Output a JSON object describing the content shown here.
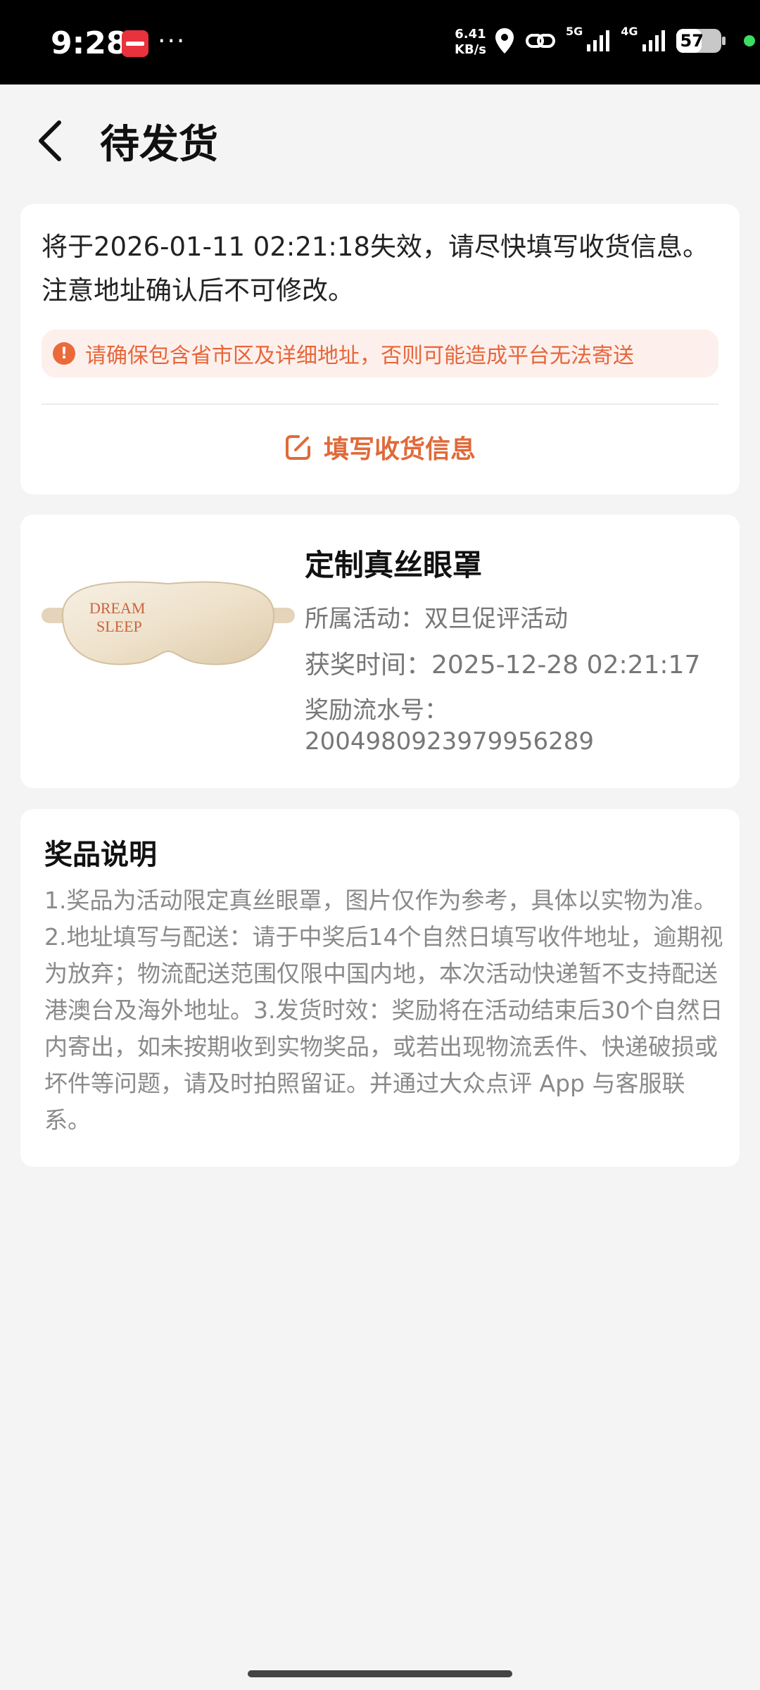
{
  "status_bar": {
    "time": "9:28",
    "dots": "···",
    "net_speed_value": "6.41",
    "net_speed_unit": "KB/s",
    "signal_5g": "5G",
    "signal_4g": "4G",
    "battery": "57",
    "battery_level": 0.57
  },
  "header": {
    "title": "待发货",
    "back_icon": "chevron-left-icon"
  },
  "address_card": {
    "expire_text": "将于2026-01-11 02:21:18失效，请尽快填写收货信息。注意地址确认后不可修改。",
    "warning_icon": "!",
    "warning_text": "请确保包含省市区及详细地址，否则可能造成平台无法寄送",
    "fill_button_label": "填写收货信息"
  },
  "product_card": {
    "name": "定制真丝眼罩",
    "activity": "所属活动：双旦促评活动",
    "award_time": "获奖时间：2025-12-28 02:21:17",
    "serial_label": "奖励流水号：",
    "serial_number": "2004980923979956289",
    "image_text": "DREAM SLEEP"
  },
  "description_card": {
    "title": "奖品说明",
    "text": "1.奖品为活动限定真丝眼罩，图片仅作为参考，具体以实物为准。2.地址填写与配送：请于中奖后14个自然日填写收件地址，逾期视为放弃；物流配送范围仅限中国内地，本次活动快递暂不支持配送港澳台及海外地址。3.发货时效：奖励将在活动结束后30个自然日内寄出，如未按期收到实物奖品，或若出现物流丢件、快递破损或坏件等问题，请及时拍照留证。并通过大众点评 App 与客服联系。"
  },
  "colors": {
    "accent": "#e06a3a",
    "warning_bg": "#fdf0ec",
    "page_bg": "#f4f4f5"
  }
}
